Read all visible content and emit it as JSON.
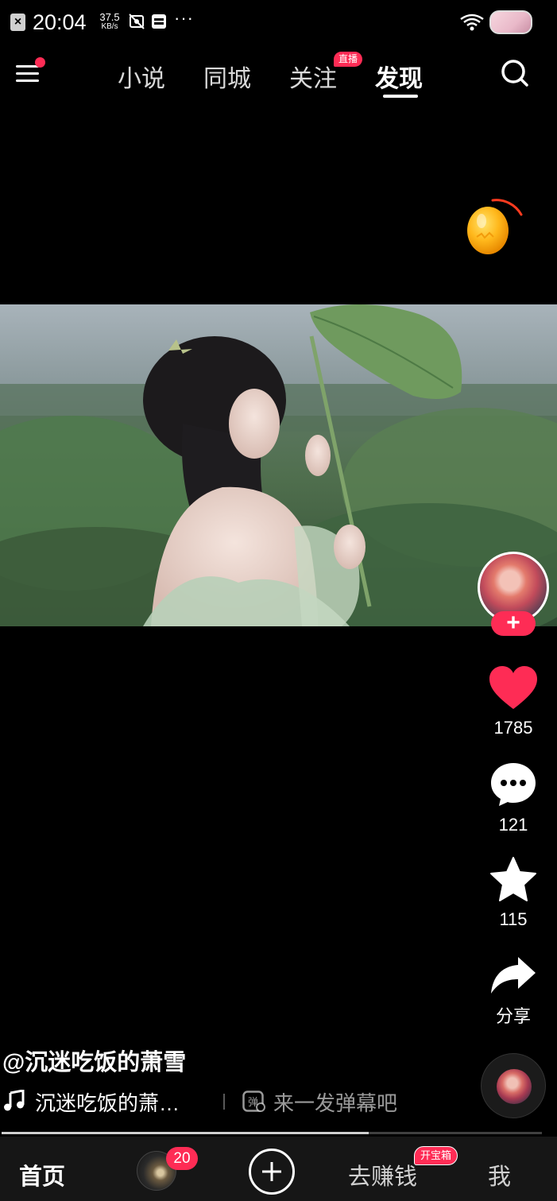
{
  "status_bar": {
    "time": "20:04",
    "speed_value": "37.5",
    "speed_unit": "KB/s",
    "more": "···"
  },
  "top_nav": {
    "tabs": [
      {
        "label": "小说"
      },
      {
        "label": "同城"
      },
      {
        "label": "关注"
      },
      {
        "label": "发现"
      }
    ],
    "live_badge": "直播"
  },
  "video": {
    "author": "@沉迷吃饭的萧雪",
    "music": "沉迷吃饭的萧…",
    "danmaku_placeholder": "来一发弹幕吧",
    "progress": 0.68
  },
  "actions": {
    "likes": "1785",
    "comments": "121",
    "favorites": "115",
    "share": "分享"
  },
  "bottom_nav": {
    "home": "首页",
    "friends_count": "20",
    "earn": "去赚钱",
    "treasure_badge": "开宝箱",
    "me": "我"
  },
  "colors": {
    "accent": "#fe2c55",
    "background": "#000000",
    "nav_background": "#161616"
  },
  "icons": [
    "menu-icon",
    "search-icon",
    "gold-egg-icon",
    "heart-icon",
    "comment-icon",
    "star-icon",
    "share-icon",
    "music-note-icon",
    "danmaku-icon",
    "plus-icon",
    "wifi-icon"
  ]
}
